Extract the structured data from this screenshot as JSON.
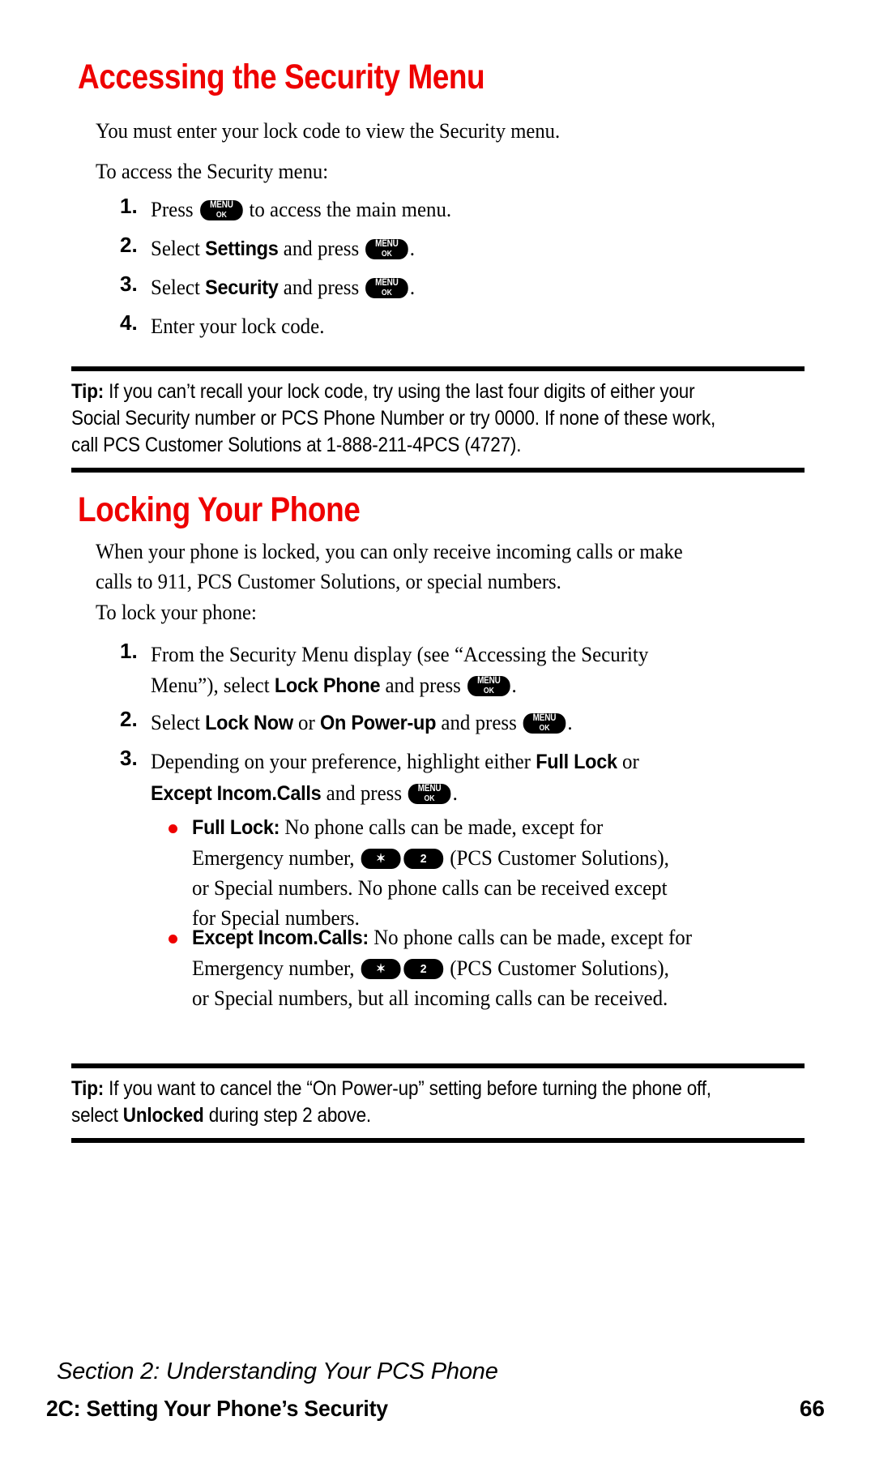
{
  "page": {
    "number": "66",
    "footer_section": "Section 2: Understanding Your PCS Phone",
    "footer_chapter": "2C: Setting Your Phone’s Security"
  },
  "keys": {
    "menu_line1": "MENU",
    "menu_line2": "OK",
    "star": "✶",
    "two": "2"
  },
  "sections": [
    {
      "heading": "Accessing the Security Menu",
      "intro": [
        "You must enter your lock code to view the Security menu.",
        "To access the Security menu:"
      ],
      "steps": [
        {
          "num": "1.",
          "parts": [
            "Press ",
            "[MENU]",
            " to access the main menu."
          ]
        },
        {
          "num": "2.",
          "parts": [
            "Select ",
            "Settings",
            " and press ",
            "[MENU]",
            "."
          ]
        },
        {
          "num": "3.",
          "parts": [
            "Select ",
            "Security",
            " and press ",
            "[MENU]",
            "."
          ]
        },
        {
          "num": "4.",
          "parts": [
            "Enter your lock code."
          ]
        }
      ],
      "tip": {
        "label": "Tip:",
        "text": "If you can’t recall your lock code, try using the last four digits of either your Social Security number or PCS Phone Number or try 0000. If none of these work, call PCS Customer Solutions at 1-888-211-4PCS (4727)."
      }
    },
    {
      "heading": "Locking Your Phone",
      "intro": [
        "When your phone is locked, you can only receive incoming calls or make calls to 911, PCS Customer Solutions, or special numbers.",
        "To lock your phone:"
      ],
      "steps": [
        {
          "num": "1.",
          "line1": "From the Security Menu display (see “Accessing the Security",
          "line2_a": "Menu”), select ",
          "line2_bold": "Lock Phone",
          "line2_b": " and press ",
          "line2_end": "."
        },
        {
          "num": "2.",
          "a": "Select ",
          "b1": "Lock Now",
          "c": " or ",
          "b2": "On Power-up",
          "d": " and press ",
          "end": "."
        },
        {
          "num": "3.",
          "line1_a": "Depending on your preference, highlight either ",
          "line1_bold": "Full Lock",
          "line1_b": " or",
          "line2_bold": "Except Incom.Calls",
          "line2_a": " and press ",
          "line2_end": "."
        }
      ],
      "bullets": [
        {
          "term": "Full Lock:",
          "l1": " No phone calls can be made, except for",
          "l2_a": "Emergency number, ",
          "l2_b": " (PCS Customer Solutions),",
          "l3": "or Special numbers. No phone calls can be received except",
          "l4": "for Special numbers."
        },
        {
          "term": "Except Incom.Calls:",
          "l1": " No phone calls can be made, except for",
          "l2_a": "Emergency number, ",
          "l2_b": " (PCS Customer Solutions),",
          "l3": "or Special numbers, but all incoming calls can be received."
        }
      ],
      "tip": {
        "label": "Tip:",
        "text_a": "If you want to cancel the “On Power-up” setting before turning the phone off, select ",
        "bold": "Unlocked",
        "text_b": " during step 2 above."
      }
    }
  ],
  "colors": {
    "heading_red": "#ee0000",
    "bullet_red": "#ee0000",
    "text_black": "#000000",
    "page_background": "#ffffff"
  }
}
